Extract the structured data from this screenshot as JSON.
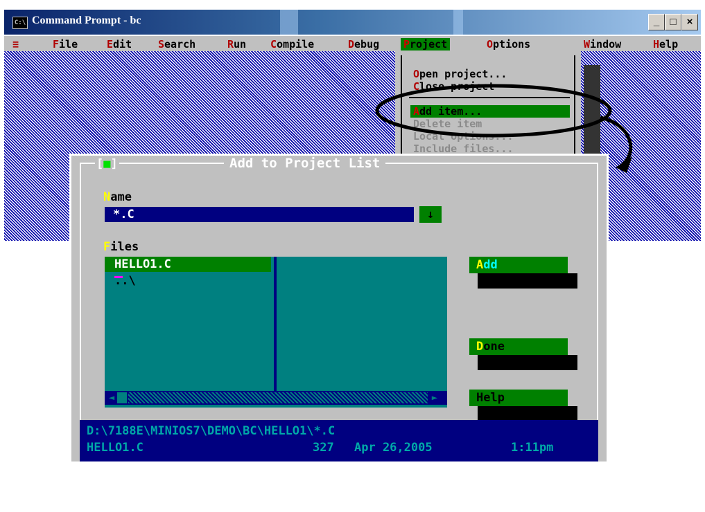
{
  "window": {
    "title": "Command Prompt - bc",
    "icon_text": "C:\\",
    "buttons": {
      "minimize": "_",
      "maximize": "□",
      "close": "×"
    }
  },
  "menubar": {
    "items": [
      {
        "hotkey": "≡",
        "rest": ""
      },
      {
        "hotkey": "F",
        "rest": "ile"
      },
      {
        "hotkey": "E",
        "rest": "dit"
      },
      {
        "hotkey": "S",
        "rest": "earch"
      },
      {
        "hotkey": "R",
        "rest": "un"
      },
      {
        "hotkey": "C",
        "rest": "ompile"
      },
      {
        "hotkey": "D",
        "rest": "ebug"
      },
      {
        "hotkey": "P",
        "rest": "roject"
      },
      {
        "hotkey": "O",
        "rest": "ptions"
      },
      {
        "hotkey": "W",
        "rest": "indow"
      },
      {
        "hotkey": "H",
        "rest": "elp"
      }
    ],
    "active": "Project"
  },
  "project_menu": {
    "items": [
      {
        "hotkey": "O",
        "rest": "pen project...",
        "state": "normal"
      },
      {
        "hotkey": "C",
        "rest": "lose project",
        "state": "normal"
      },
      {
        "hotkey": "A",
        "rest": "dd item...",
        "state": "selected"
      },
      {
        "hotkey": "",
        "rest": "Delete item",
        "state": "disabled"
      },
      {
        "hotkey": "",
        "rest": "Local options...",
        "state": "disabled"
      },
      {
        "hotkey": "",
        "rest": "Include files...",
        "state": "disabled"
      }
    ]
  },
  "dialog": {
    "title": "Add to Project List",
    "close_box": "[■]",
    "name_label": {
      "hotkey": "N",
      "rest": "ame"
    },
    "name_value": "*.C",
    "name_dropdown_glyph": "↓",
    "files_label": {
      "hotkey": "F",
      "rest": "iles"
    },
    "files": [
      "HELLO1.C",
      "..\\"
    ],
    "scroll_left": "◄",
    "scroll_right": "►",
    "buttons": {
      "add": {
        "hotkey": "A",
        "rest": "dd"
      },
      "done": {
        "hotkey": "D",
        "rest": "one"
      },
      "help": {
        "hotkey": "",
        "rest": "Help"
      }
    },
    "status": {
      "path": "D:\\7188E\\MINIOS7\\DEMO\\BC\\HELLO1\\*.C",
      "file": "HELLO1.C",
      "size": "327",
      "date": "Apr 26,2005",
      "time": "1:11pm"
    }
  },
  "colors": {
    "menu_green": "#008000",
    "dialog_gray": "#c0c0c0",
    "list_teal": "#008080",
    "navy": "#000080",
    "hotkey_red": "#b00000",
    "hotkey_yellow": "#ffff00"
  }
}
